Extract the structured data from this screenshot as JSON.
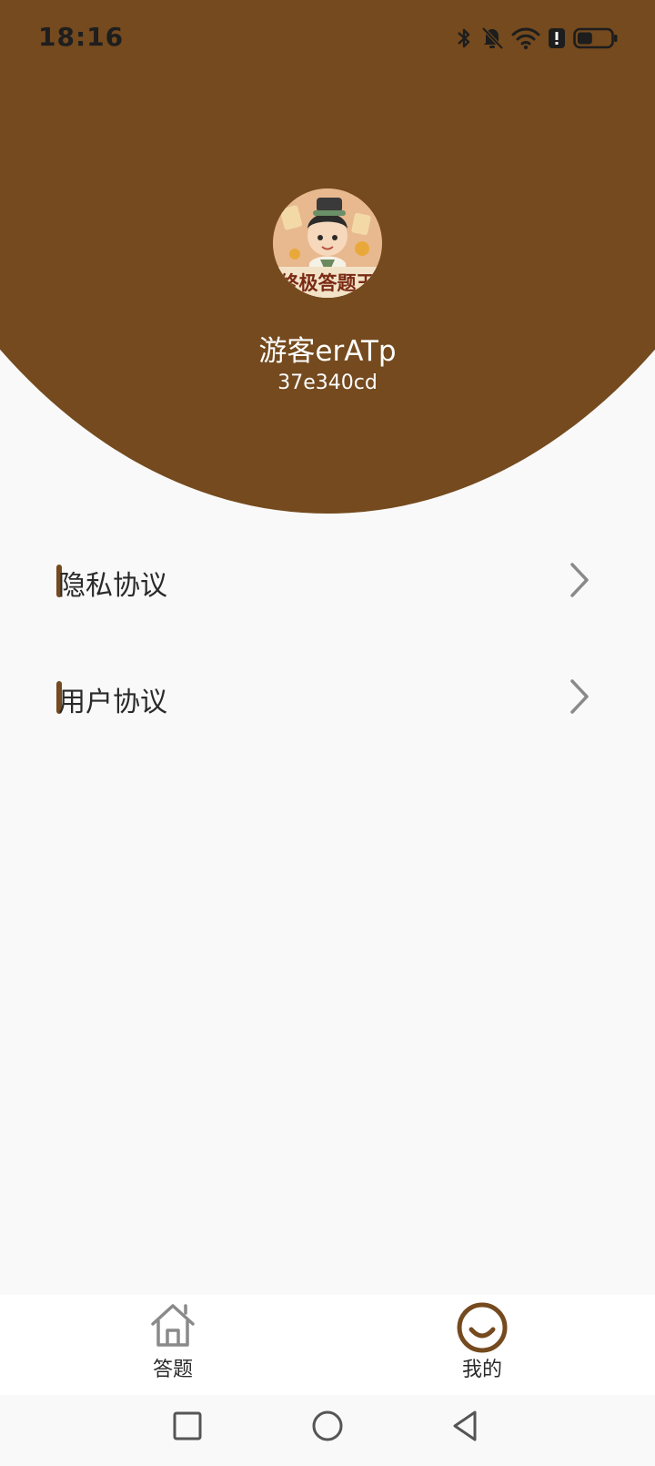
{
  "status_bar": {
    "time": "18:16",
    "icons": [
      "bluetooth-icon",
      "bell-muted-icon",
      "wifi-icon",
      "alert-icon",
      "battery-icon"
    ],
    "battery_level": 0.45
  },
  "profile": {
    "avatar_text": "终极答题王",
    "name": "游客erATp",
    "id": "37e340cd"
  },
  "menu": [
    {
      "label": "隐私协议",
      "icon": "chevron-right-icon"
    },
    {
      "label": "用户协议",
      "icon": "chevron-right-icon"
    }
  ],
  "bottom_nav": [
    {
      "label": "答题",
      "icon": "home-icon",
      "active": false
    },
    {
      "label": "我的",
      "icon": "smile-icon",
      "active": true
    }
  ],
  "system_nav": [
    "recent-apps-icon",
    "home-circle-icon",
    "back-icon"
  ],
  "colors": {
    "accent": "#744a1e",
    "background": "#f9f9f9",
    "nav_background": "#ffffff"
  }
}
